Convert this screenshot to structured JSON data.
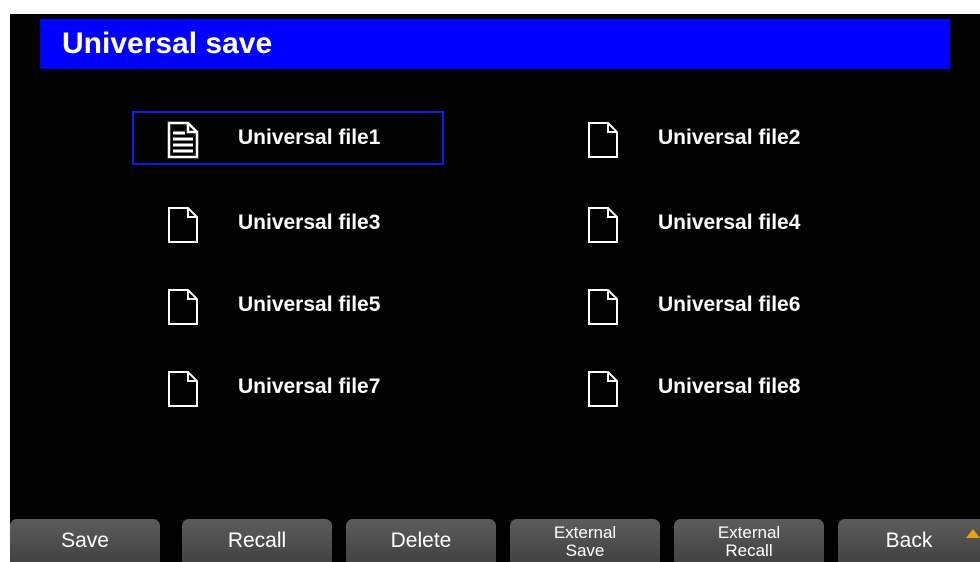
{
  "title": "Universal save",
  "files": [
    {
      "label": "Universal file1",
      "icon": "document-lines-icon",
      "selected": true
    },
    {
      "label": "Universal file2",
      "icon": "blank-document-icon",
      "selected": false
    },
    {
      "label": "Universal file3",
      "icon": "blank-document-icon",
      "selected": false
    },
    {
      "label": "Universal file4",
      "icon": "blank-document-icon",
      "selected": false
    },
    {
      "label": "Universal file5",
      "icon": "blank-document-icon",
      "selected": false
    },
    {
      "label": "Universal file6",
      "icon": "blank-document-icon",
      "selected": false
    },
    {
      "label": "Universal file7",
      "icon": "blank-document-icon",
      "selected": false
    },
    {
      "label": "Universal file8",
      "icon": "blank-document-icon",
      "selected": false
    }
  ],
  "softkeys": {
    "save": {
      "line1": "Save"
    },
    "recall": {
      "line1": "Recall"
    },
    "delete": {
      "line1": "Delete"
    },
    "external_save": {
      "line1": "External",
      "line2": "Save"
    },
    "external_recall": {
      "line1": "External",
      "line2": "Recall"
    },
    "back": {
      "line1": "Back"
    }
  },
  "colors": {
    "title_bar": "#0000ff",
    "selection_border": "#0a1ee6",
    "background": "#000000",
    "scroll_indicator": "#f39c12"
  }
}
